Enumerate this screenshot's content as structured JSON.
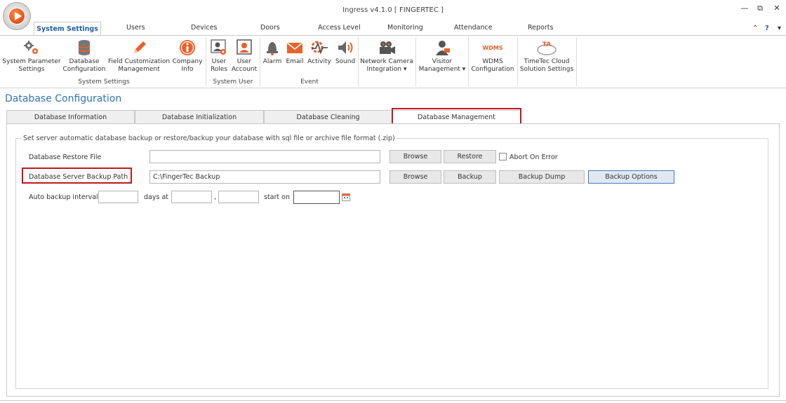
{
  "window": {
    "title": "Ingress v4.1.0 [ FINGERTEC ]",
    "controls": [
      "—",
      "⧉",
      "✕"
    ]
  },
  "ribbon": {
    "tabs": [
      "System Settings",
      "Users",
      "Devices",
      "Doors",
      "Access Level",
      "Monitoring",
      "Attendance",
      "Reports"
    ],
    "help_glyphs": [
      "⌃",
      "?",
      "▾"
    ],
    "buttons": {
      "sys_param": "System Parameter\nSettings",
      "db_config": "Database\nConfiguration",
      "field_custom": "Field Customization\nManagement",
      "company_info": "Company\nInfo",
      "user_roles": "User\nRoles",
      "user_account": "User\nAccount",
      "alarm": "Alarm",
      "email": "Email",
      "activity": "Activity",
      "sound": "Sound",
      "network_camera": "Network Camera\nIntegration ▾",
      "visitor": "Visitor\nManagement ▾",
      "wdms": "WDMS\nConfiguration",
      "timetec": "TimeTec Cloud\nSolution Settings"
    },
    "wdms_logo_text": "WDMS",
    "groups": {
      "system_settings": "System Settings",
      "system_user": "System User",
      "event": "Event"
    }
  },
  "page": {
    "title": "Database Configuration",
    "tabs": [
      "Database Information",
      "Database Initialization",
      "Database Cleaning",
      "Database Management"
    ],
    "active_tab": "Database Management",
    "group_caption": "Set server automatic database backup or restore/backup your database with sql file or archive file format (.zip)",
    "restore": {
      "label": "Database Restore File",
      "value": "",
      "browse": "Browse",
      "restore": "Restore",
      "abort_label": "Abort On Error",
      "abort_checked": false
    },
    "backup": {
      "label": "Database Server Backup Path",
      "value": "C:\\FingerTec Backup",
      "browse": "Browse",
      "backup": "Backup",
      "dump": "Backup Dump",
      "options": "Backup Options"
    },
    "auto": {
      "label": "Auto backup interval",
      "days_at": "days at",
      "comma": ",",
      "start_on": "start on",
      "interval_value": "",
      "time1": "",
      "time2": "",
      "start_value": ""
    }
  },
  "colors": {
    "accent": "#2e75b6",
    "highlight_box": "#c0191f",
    "icon_orange": "#e8622a"
  }
}
